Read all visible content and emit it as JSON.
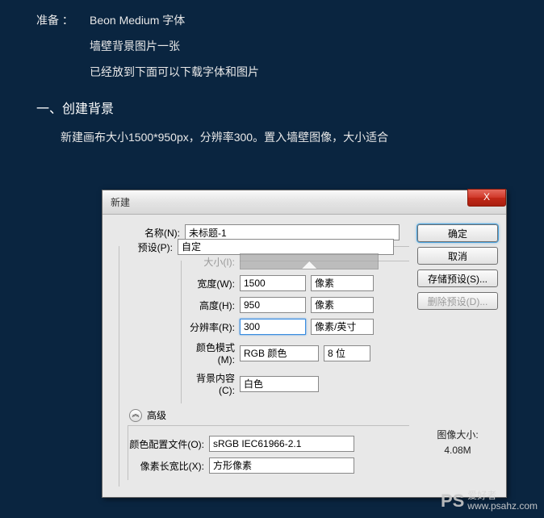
{
  "prep": {
    "label": "准备 ：",
    "items": [
      "Beon Medium 字体",
      "墙壁背景图片一张",
      "已经放到下面可以下载字体和图片"
    ]
  },
  "section": {
    "title": "一、创建背景",
    "desc": "新建画布大小1500*950px，分辨率300。置入墙壁图像，大小适合"
  },
  "dialog": {
    "title": "新建",
    "labels": {
      "name": "名称(N):",
      "preset": "预设(P):",
      "size": "大小(I):",
      "width": "宽度(W):",
      "height": "高度(H):",
      "resolution": "分辨率(R):",
      "colorMode": "颜色模式(M):",
      "background": "背景内容(C):",
      "advanced": "高级",
      "profile": "颜色配置文件(O):",
      "aspect": "像素长宽比(X):"
    },
    "values": {
      "name": "未标题-1",
      "preset": "自定",
      "width": "1500",
      "height": "950",
      "resolution": "300",
      "widthUnit": "像素",
      "heightUnit": "像素",
      "resolutionUnit": "像素/英寸",
      "colorMode": "RGB 颜色",
      "bits": "8 位",
      "background": "白色",
      "profile": "sRGB IEC61966-2.1",
      "aspect": "方形像素"
    },
    "buttons": {
      "ok": "确定",
      "cancel": "取消",
      "savePreset": "存储预设(S)...",
      "deletePreset": "删除预设(D)..."
    },
    "info": {
      "sizeLabel": "图像大小:",
      "sizeValue": "4.08M"
    }
  },
  "watermark": {
    "ps": "PS",
    "chars": "爱好者",
    "url": "www.psahz.com"
  }
}
